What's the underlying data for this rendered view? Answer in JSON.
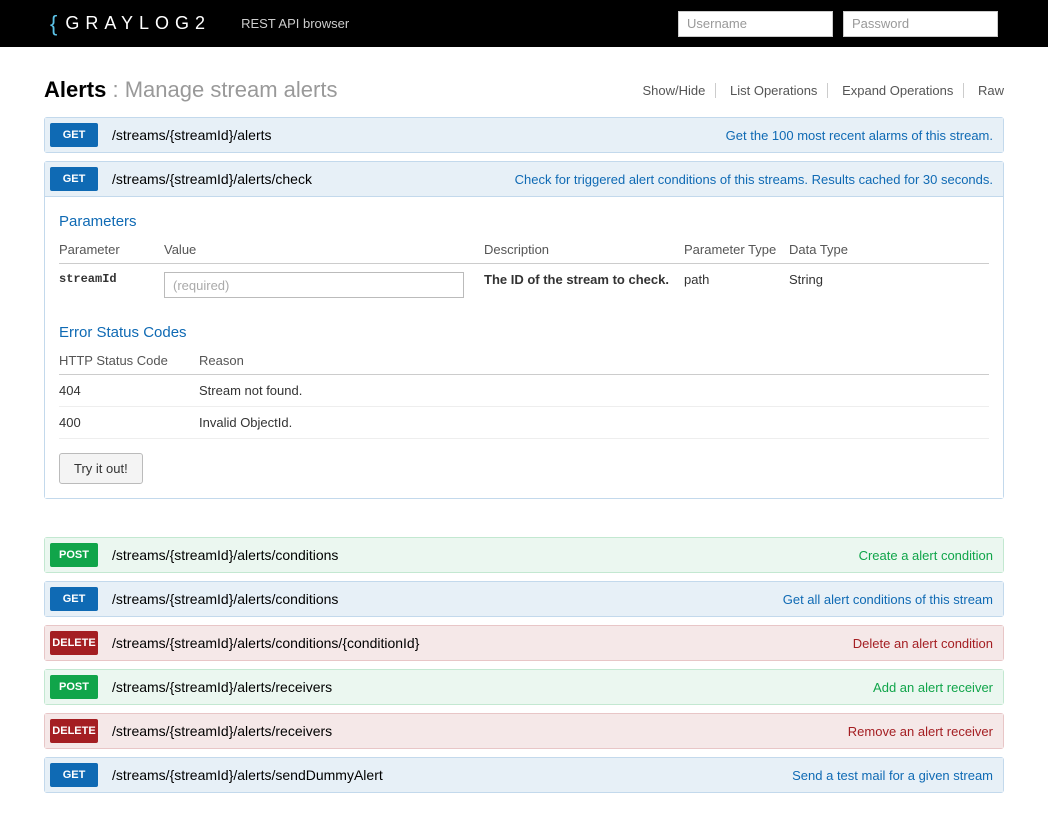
{
  "topbar": {
    "logo_text": "GRAYLOG2",
    "subtitle": "REST API browser",
    "username_placeholder": "Username",
    "password_placeholder": "Password"
  },
  "heading": {
    "bold": "Alerts",
    "sep": " : ",
    "light": "Manage stream alerts"
  },
  "links": {
    "show_hide": "Show/Hide",
    "list": "List Operations",
    "expand": "Expand Operations",
    "raw": "Raw"
  },
  "ops": [
    {
      "method": "GET",
      "path": "/streams/{streamId}/alerts",
      "desc": "Get the 100 most recent alarms of this stream."
    },
    {
      "method": "GET",
      "path": "/streams/{streamId}/alerts/check",
      "desc": "Check for triggered alert conditions of this streams. Results cached for 30 seconds."
    }
  ],
  "detail": {
    "params_title": "Parameters",
    "th": {
      "param": "Parameter",
      "value": "Value",
      "desc": "Description",
      "ptype": "Parameter Type",
      "dtype": "Data Type"
    },
    "row": {
      "param": "streamId",
      "placeholder": "(required)",
      "desc": "The ID of the stream to check.",
      "ptype": "path",
      "dtype": "String"
    },
    "errors_title": "Error Status Codes",
    "eth": {
      "code": "HTTP Status Code",
      "reason": "Reason"
    },
    "errors": [
      {
        "code": "404",
        "reason": "Stream not found."
      },
      {
        "code": "400",
        "reason": "Invalid ObjectId."
      }
    ],
    "try": "Try it out!"
  },
  "ops2": [
    {
      "method": "POST",
      "path": "/streams/{streamId}/alerts/conditions",
      "desc": "Create a alert condition"
    },
    {
      "method": "GET",
      "path": "/streams/{streamId}/alerts/conditions",
      "desc": "Get all alert conditions of this stream"
    },
    {
      "method": "DELETE",
      "path": "/streams/{streamId}/alerts/conditions/{conditionId}",
      "desc": "Delete an alert condition"
    },
    {
      "method": "POST",
      "path": "/streams/{streamId}/alerts/receivers",
      "desc": "Add an alert receiver"
    },
    {
      "method": "DELETE",
      "path": "/streams/{streamId}/alerts/receivers",
      "desc": "Remove an alert receiver"
    },
    {
      "method": "GET",
      "path": "/streams/{streamId}/alerts/sendDummyAlert",
      "desc": "Send a test mail for a given stream"
    }
  ]
}
